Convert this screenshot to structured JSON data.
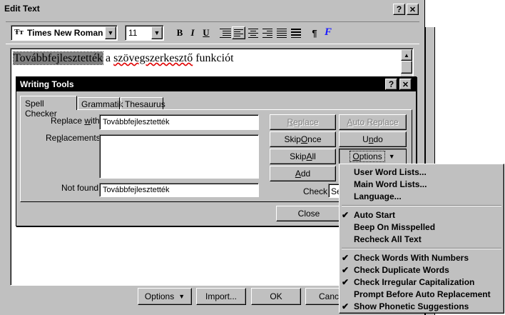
{
  "outer_window": {
    "title": "Edit Text",
    "help_label": "?",
    "close_label": "✕"
  },
  "toolbar": {
    "font_name": "Times New Roman",
    "font_size": "11",
    "bold_label": "B",
    "italic_label": "I",
    "underline_label": "U",
    "pilcrow_label": "¶"
  },
  "document": {
    "highlighted_word": "Továbbfejlesztették",
    "rest_text": " a szövegszerkesztő funkciót",
    "underlined_word": "szövegszerkesztő"
  },
  "writing_tools": {
    "title": "Writing Tools",
    "help_label": "?",
    "close_label": "✕",
    "tabs": [
      {
        "label": "Spell Checker"
      },
      {
        "label": "Grammatik"
      },
      {
        "label": "Thesaurus"
      }
    ],
    "replace_with_label": "Replace with:",
    "replace_with_value": "Továbbfejlesztették",
    "replacements_label": "Replacements:",
    "not_found_label": "Not found:",
    "not_found_value": "Továbbfejlesztették",
    "check_label": "Check:",
    "check_value_partial": "Se",
    "buttons": {
      "replace": "Replace",
      "auto_replace": "Auto Replace",
      "skip_once": "Skip Once",
      "undo": "Undo",
      "skip_all": "Skip All",
      "options": "Options",
      "add": "Add",
      "close": "Close"
    }
  },
  "options_menu": {
    "group1": [
      "User Word Lists...",
      "Main Word Lists...",
      "Language..."
    ],
    "group2": [
      {
        "label": "Auto Start",
        "checked": true
      },
      {
        "label": "Beep On Misspelled",
        "checked": false
      },
      {
        "label": "Recheck All Text",
        "checked": false
      }
    ],
    "group3": [
      {
        "label": "Check Words With Numbers",
        "checked": true
      },
      {
        "label": "Check Duplicate Words",
        "checked": true
      },
      {
        "label": "Check Irregular Capitalization",
        "checked": true
      },
      {
        "label": "Prompt Before Auto Replacement",
        "checked": false
      },
      {
        "label": "Show Phonetic Suggestions",
        "checked": true
      }
    ],
    "check_mark": "✔"
  },
  "bottom_buttons": {
    "options": "Options",
    "import": "Import...",
    "ok": "OK",
    "cancel_partial": "Cance"
  }
}
